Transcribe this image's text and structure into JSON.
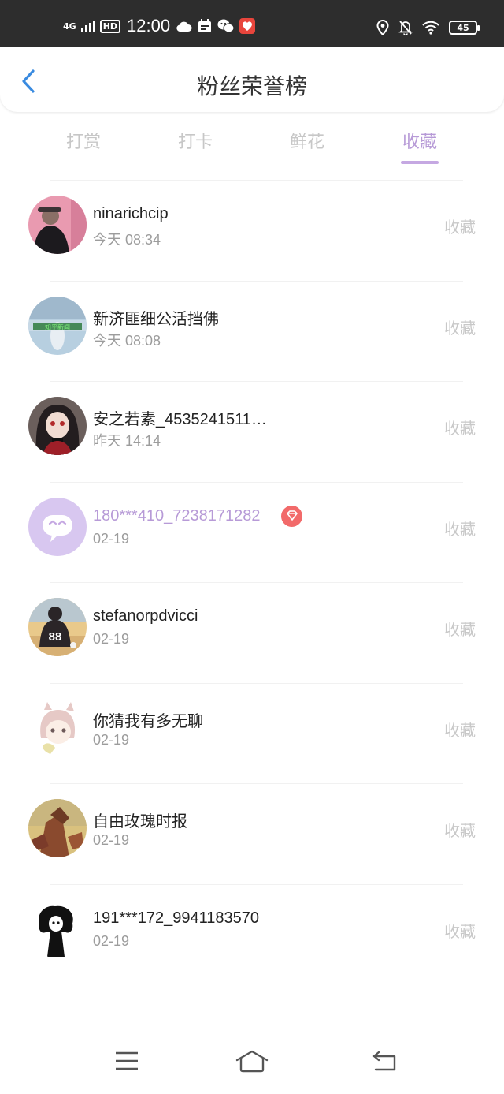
{
  "status_bar": {
    "network": "4G",
    "hd": "HD",
    "time": "12:00",
    "battery": "45"
  },
  "header": {
    "title": "粉丝荣誉榜"
  },
  "tabs": [
    {
      "label": "打赏",
      "active": false
    },
    {
      "label": "打卡",
      "active": false
    },
    {
      "label": "鲜花",
      "active": false
    },
    {
      "label": "收藏",
      "active": true
    }
  ],
  "fans": [
    {
      "name": "ninarichcip",
      "time": "今天 08:34",
      "action": "收藏"
    },
    {
      "name": "新济匪细公活挡佛",
      "time": "今天 08:08",
      "action": "收藏"
    },
    {
      "name": "安之若素_4535241511…",
      "time": "昨天 14:14",
      "action": "收藏"
    },
    {
      "name": "180***410_7238171282",
      "time": "02-19",
      "action": "收藏",
      "vip": true
    },
    {
      "name": "stefanorpdvicci",
      "time": "02-19",
      "action": "收藏"
    },
    {
      "name": "你猜我有多无聊",
      "time": "02-19",
      "action": "收藏"
    },
    {
      "name": "自由玫瑰时报",
      "time": "02-19",
      "action": "收藏"
    },
    {
      "name": "191***172_9941183570",
      "time": "02-19",
      "action": "收藏"
    }
  ],
  "avatar_texts": {
    "fan2": "知乎新闻",
    "fan5": "88"
  },
  "colors": {
    "accent": "#b79ad7",
    "back_arrow": "#3a8be0",
    "vip_badge": "#f26a6a",
    "status_bar_bg": "#2d2d2d"
  },
  "icons": {
    "back": "chevron-left-icon",
    "vip": "diamond-icon",
    "nav": [
      "menu-icon",
      "home-icon",
      "return-icon"
    ]
  }
}
